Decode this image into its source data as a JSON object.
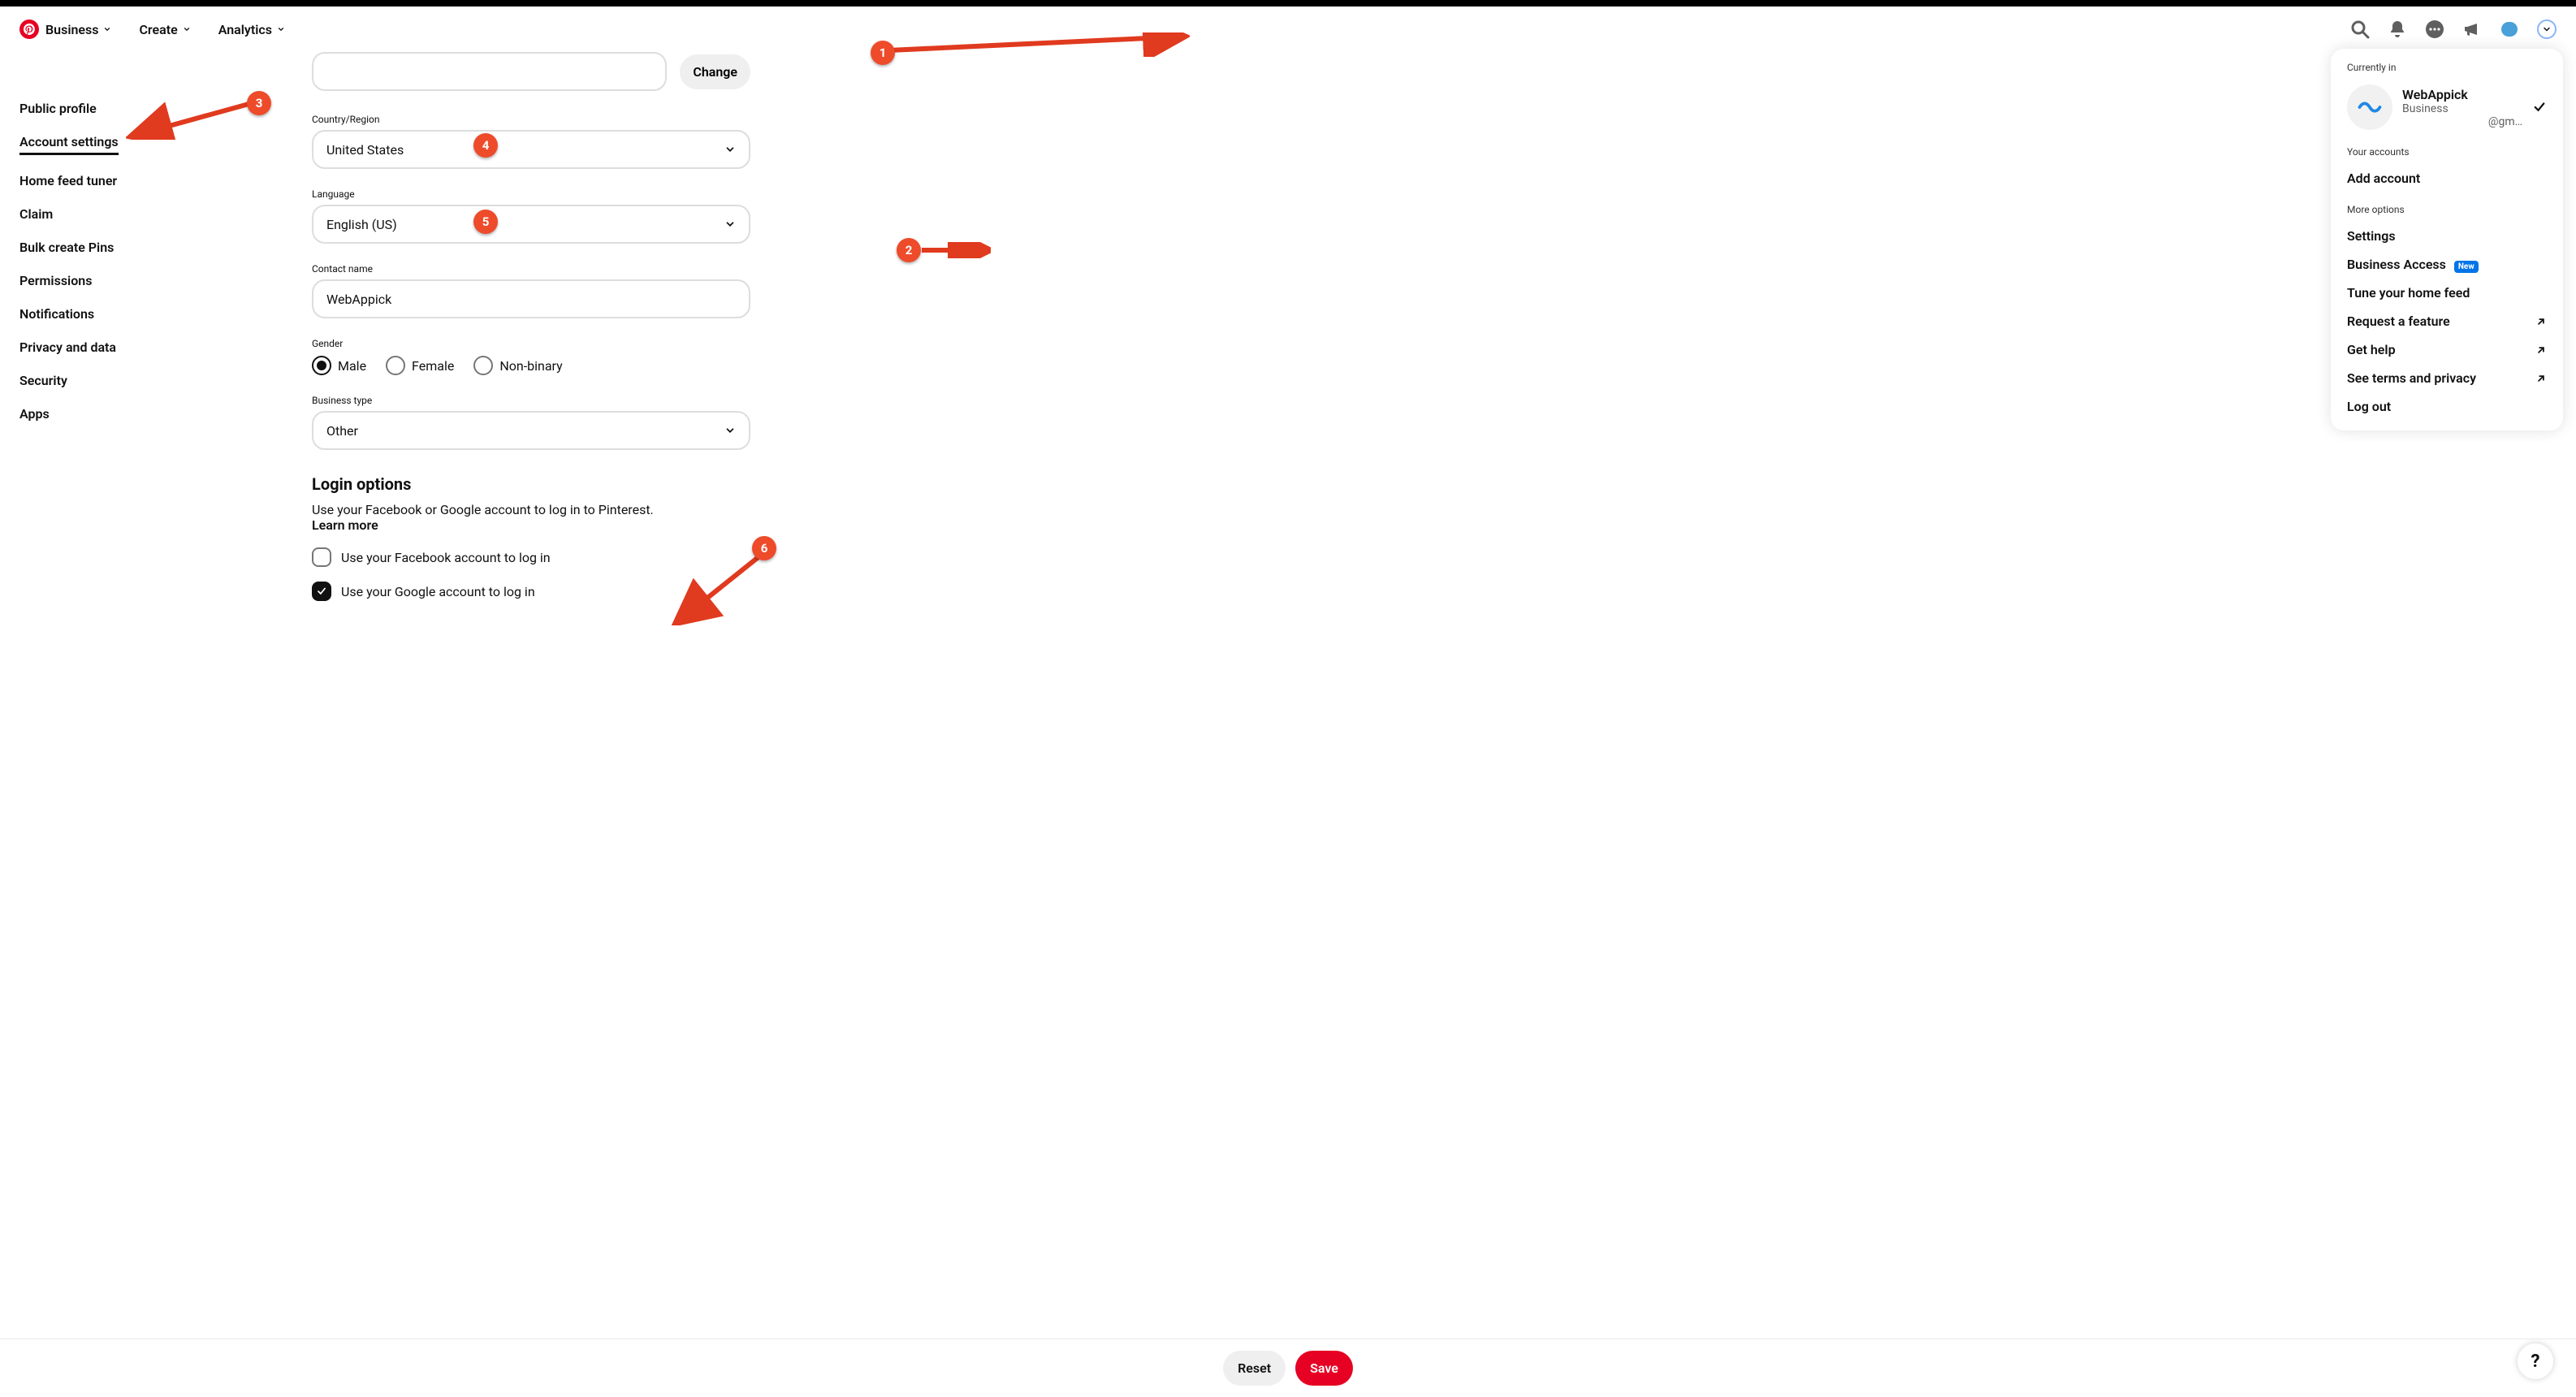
{
  "nav": {
    "business": "Business",
    "create": "Create",
    "analytics": "Analytics"
  },
  "sidebar": {
    "items": [
      "Public profile",
      "Account settings",
      "Home feed tuner",
      "Claim",
      "Bulk create Pins",
      "Permissions",
      "Notifications",
      "Privacy and data",
      "Security",
      "Apps"
    ]
  },
  "form": {
    "change": "Change",
    "country_label": "Country/Region",
    "country_value": "United States",
    "language_label": "Language",
    "language_value": "English (US)",
    "contact_label": "Contact name",
    "contact_value": "WebAppick",
    "gender_label": "Gender",
    "gender_options": {
      "male": "Male",
      "female": "Female",
      "nonbinary": "Non-binary"
    },
    "gender_selected": "male",
    "biztype_label": "Business type",
    "biztype_value": "Other",
    "login_heading": "Login options",
    "login_desc": "Use your Facebook or Google account to log in to Pinterest.",
    "login_learn": "Learn more",
    "fb_login": "Use your Facebook account to log in",
    "google_login": "Use your Google account to log in"
  },
  "footer": {
    "reset": "Reset",
    "save": "Save"
  },
  "dropdown": {
    "currently_in": "Currently in",
    "account_name": "WebAppick",
    "account_type": "Business",
    "account_email": "@gm…",
    "your_accounts": "Your accounts",
    "add_account": "Add account",
    "more_options": "More options",
    "settings": "Settings",
    "business_access": "Business Access",
    "new_badge": "New",
    "tune_feed": "Tune your home feed",
    "request_feature": "Request a feature",
    "get_help": "Get help",
    "terms": "See terms and privacy",
    "logout": "Log out"
  },
  "annotations": [
    "1",
    "2",
    "3",
    "4",
    "5",
    "6"
  ]
}
